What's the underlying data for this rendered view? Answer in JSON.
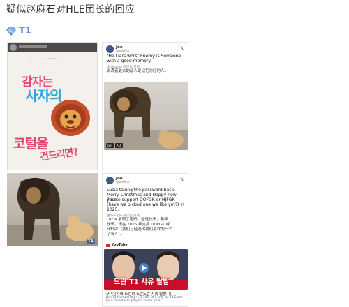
{
  "post": {
    "title": "疑似赵麻石对HLE团长的回应",
    "tag_label": "T1",
    "tag_color": "#5b8fd6",
    "tag_icon": "diamond-icon"
  },
  "book_cover": {
    "line1": "감자는",
    "line2": "사자의",
    "line3": "코털을",
    "line4": "건드리면?",
    "colors": {
      "pink": "#e04468",
      "blue": "#2ea3d9"
    }
  },
  "tweet1": {
    "user": "Joe",
    "handle": "@JoeMar",
    "text": [
      "tHe Liars worst Enemy is Someone",
      "with a good memory."
    ],
    "translate_label": "由 Google 翻译自 英语",
    "translation": "说谎者最大的敌人是记忆力好的人。",
    "alt_badges": [
      "GIF",
      "ALT"
    ]
  },
  "photo_watermark": "T1",
  "tweet2": {
    "user": "Joe",
    "handle": "@JoeMar",
    "text": [
      "Lucia taking the password back.",
      "Merry Christmas and Happy new year.",
      "Please support DOFGK or HJFGK",
      "(have we picked one we like yet?) in",
      "2025."
    ],
    "translate_label": "由 Google 翻译自 英语",
    "translation": [
      "Lucia 拿回了密码。圣诞快乐，新年",
      "快乐。请在 2025 年支持 DOFGK 或",
      "HJFGK（我们已经选出我们喜欢的一个",
      "了吗？）。"
    ],
    "youtube_label": "YouTube",
    "video_thumb_text": "도란 T1 사유 탈밤",
    "video_title": "구마유시와 도란의 도란도란 사복 탈밤기!",
    "video_desc": "Join T1 Membership: (1) 10% OFF only for T1 Enter your favorite T1 player's name for a..."
  }
}
